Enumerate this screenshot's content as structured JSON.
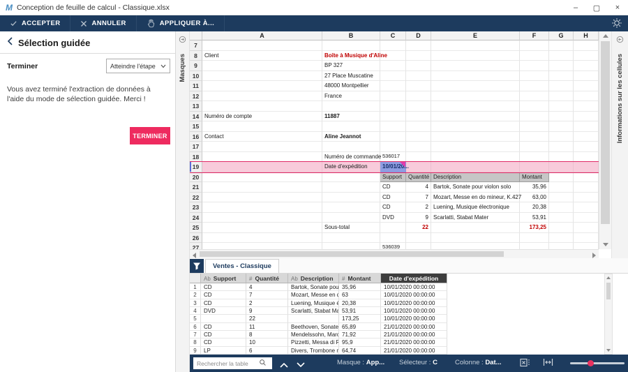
{
  "window": {
    "title": "Conception de feuille de calcul - Classique.xlsx",
    "logo": "M",
    "controls": {
      "minimize": "–",
      "maximize": "▢",
      "close": "×"
    }
  },
  "toolbar": {
    "accept": "ACCEPTER",
    "cancel": "ANNULER",
    "apply_to": "APPLIQUER À..."
  },
  "left_panel": {
    "title": "Sélection guidée",
    "step_label": "Terminer",
    "step_dropdown": "Atteindre l'étape",
    "message": "Vous avez terminé l'extraction de données à l'aide du mode de sélection guidée. Merci !",
    "finish_button": "TERMINER"
  },
  "left_tab": "Masques",
  "right_tab": "Informations sur les cellules",
  "spreadsheet": {
    "columns": [
      "A",
      "B",
      "C",
      "D",
      "E",
      "F",
      "G",
      "H"
    ],
    "rows": [
      {
        "n": "7",
        "cells": []
      },
      {
        "n": "8",
        "cells": [
          {
            "col": "A",
            "text": "Client"
          },
          {
            "col": "B",
            "text": "Boîte à Musique d'Aline",
            "style": "red bold"
          }
        ]
      },
      {
        "n": "9",
        "cells": [
          {
            "col": "B",
            "text": "BP 327"
          }
        ]
      },
      {
        "n": "10",
        "cells": [
          {
            "col": "B",
            "text": "27 Place Muscatine"
          }
        ]
      },
      {
        "n": "11",
        "cells": [
          {
            "col": "B",
            "text": "48000 Montpellier"
          }
        ]
      },
      {
        "n": "12",
        "cells": [
          {
            "col": "B",
            "text": "France"
          }
        ]
      },
      {
        "n": "13",
        "cells": []
      },
      {
        "n": "14",
        "cells": [
          {
            "col": "A",
            "text": "Numéro de compte"
          },
          {
            "col": "B",
            "text": "11887",
            "style": "bold"
          }
        ]
      },
      {
        "n": "15",
        "cells": []
      },
      {
        "n": "16",
        "cells": [
          {
            "col": "A",
            "text": "Contact"
          },
          {
            "col": "B",
            "text": "Aline Jeannot",
            "style": "bold"
          }
        ]
      },
      {
        "n": "17",
        "cells": []
      },
      {
        "n": "18",
        "cells": [
          {
            "col": "B",
            "text": "Numéro de commande"
          },
          {
            "col": "C",
            "text": "536017",
            "style": "tiny"
          }
        ]
      },
      {
        "n": "19",
        "highlight": true,
        "cells": [
          {
            "col": "B",
            "text": "Date d'expédition"
          },
          {
            "col": "C",
            "text": "10/01/20...",
            "style": "sel"
          }
        ]
      },
      {
        "n": "20",
        "cells": [
          {
            "col": "C",
            "text": "Support",
            "style": "colhdr"
          },
          {
            "col": "D",
            "text": "Quantité",
            "style": "colhdr"
          },
          {
            "col": "E",
            "text": "Description",
            "style": "colhdr"
          },
          {
            "col": "F",
            "text": "Montant",
            "style": "colhdr"
          }
        ]
      },
      {
        "n": "21",
        "cells": [
          {
            "col": "C",
            "text": "CD"
          },
          {
            "col": "D",
            "text": "4",
            "style": "num"
          },
          {
            "col": "E",
            "text": "Bartok, Sonate pour violon solo"
          },
          {
            "col": "F",
            "text": "35,96",
            "style": "num"
          }
        ]
      },
      {
        "n": "22",
        "cells": [
          {
            "col": "C",
            "text": "CD"
          },
          {
            "col": "D",
            "text": "7",
            "style": "num"
          },
          {
            "col": "E",
            "text": "Mozart, Messe en do mineur, K.427"
          },
          {
            "col": "F",
            "text": "63,00",
            "style": "num"
          }
        ]
      },
      {
        "n": "23",
        "cells": [
          {
            "col": "C",
            "text": "CD"
          },
          {
            "col": "D",
            "text": "2",
            "style": "num"
          },
          {
            "col": "E",
            "text": "Luening, Musique électronique"
          },
          {
            "col": "F",
            "text": "20,38",
            "style": "num"
          }
        ]
      },
      {
        "n": "24",
        "cells": [
          {
            "col": "C",
            "text": "DVD"
          },
          {
            "col": "D",
            "text": "9",
            "style": "num"
          },
          {
            "col": "E",
            "text": "Scarlatti, Stabat Mater"
          },
          {
            "col": "F",
            "text": "53,91",
            "style": "num"
          }
        ]
      },
      {
        "n": "25",
        "cells": [
          {
            "col": "B",
            "text": "Sous-total"
          },
          {
            "col": "D",
            "text": "22",
            "style": "num red bold"
          },
          {
            "col": "F",
            "text": "173,25",
            "style": "num red bold"
          }
        ]
      },
      {
        "n": "26",
        "cells": []
      },
      {
        "n": "27",
        "cells": [
          {
            "col": "C",
            "text": "536039",
            "style": "tiny"
          }
        ]
      }
    ]
  },
  "table_tab": {
    "label": "Ventes - Classique"
  },
  "table": {
    "columns": [
      {
        "type": "Ab",
        "label": "Support"
      },
      {
        "type": "#",
        "label": "Quantité"
      },
      {
        "type": "Ab",
        "label": "Description"
      },
      {
        "type": "#",
        "label": "Montant"
      },
      {
        "type": "",
        "label": "Date d'expédition",
        "selected": true
      }
    ],
    "rows": [
      [
        "1",
        "CD",
        "4",
        "Bartok, Sonate pour...",
        "35,96",
        "10/01/2020 00:00:00"
      ],
      [
        "2",
        "CD",
        "7",
        "Mozart, Messe en do...",
        "63",
        "10/01/2020 00:00:00"
      ],
      [
        "3",
        "CD",
        "2",
        "Luening, Musique éle...",
        "20,38",
        "10/01/2020 00:00:00"
      ],
      [
        "4",
        "DVD",
        "9",
        "Scarlatti, Stabat Mater",
        "53,91",
        "10/01/2020 00:00:00"
      ],
      [
        "5",
        "",
        "22",
        "",
        "173,25",
        "10/01/2020 00:00:00"
      ],
      [
        "6",
        "CD",
        "11",
        "Beethoven, Sonate P...",
        "65,89",
        "21/01/2020 00:00:00"
      ],
      [
        "7",
        "CD",
        "8",
        "Mendelssohn, March...",
        "71,92",
        "21/01/2020 00:00:00"
      ],
      [
        "8",
        "CD",
        "10",
        "Pizzetti, Messa di Re...",
        "95,9",
        "21/01/2020 00:00:00"
      ],
      [
        "9",
        "LP",
        "6",
        "Divers, Trombone mo...",
        "64,74",
        "21/01/2020 00:00:00"
      ]
    ]
  },
  "statusbar": {
    "search_placeholder": "Rechercher la table",
    "masque_label": "Masque :",
    "masque_value": "App...",
    "selecteur_label": "Sélecteur :",
    "selecteur_value": "C",
    "colonne_label": "Colonne :",
    "colonne_value": "Dat..."
  },
  "colors": {
    "navy": "#1d3b5e",
    "accent_pink": "#ee2b5f",
    "row_highlight": "#f8cbdb",
    "row_highlight_border": "#e02a66",
    "selected_cell": "#8f9de2",
    "selected_cell_triangle": "#e23cae",
    "red_text": "#c00000"
  }
}
